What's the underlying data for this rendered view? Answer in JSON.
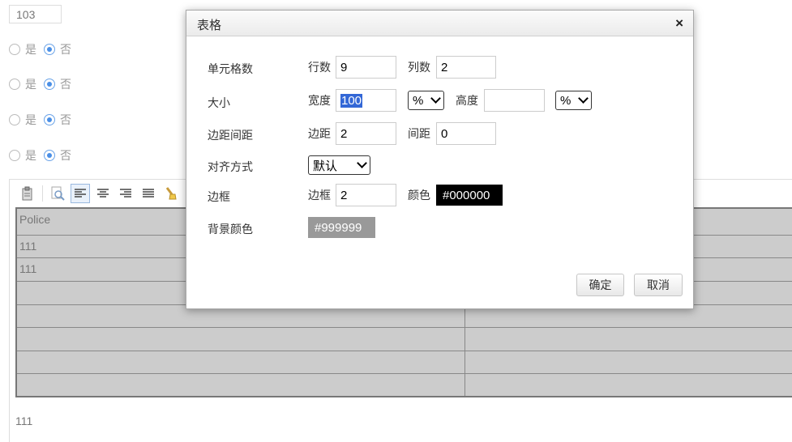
{
  "page": {
    "top_input_value": "103",
    "radio_rows": [
      {
        "yes": "是",
        "no": "否",
        "selected": "no"
      },
      {
        "yes": "是",
        "no": "否",
        "selected": "no"
      },
      {
        "yes": "是",
        "no": "否",
        "selected": "no"
      },
      {
        "yes": "是",
        "no": "否",
        "selected": "no"
      }
    ],
    "toolbar_icons": [
      "paste-icon",
      "preview-icon",
      "align-left-icon",
      "align-center-icon",
      "align-right-icon",
      "justify-icon",
      "brush-icon"
    ],
    "table": {
      "header": "Police",
      "rows": [
        "111",
        "111",
        "",
        "",
        "",
        "",
        ""
      ]
    },
    "after_table_text": "111"
  },
  "dialog": {
    "title": "表格",
    "close_glyph": "×",
    "cells": {
      "label": "单元格数",
      "rows_label": "行数",
      "rows_value": "9",
      "cols_label": "列数",
      "cols_value": "2"
    },
    "size": {
      "label": "大小",
      "width_label": "宽度",
      "width_value": "100",
      "width_unit": "%",
      "height_label": "高度",
      "height_value": "",
      "height_unit": "%"
    },
    "spacing": {
      "label": "边距间距",
      "padding_label": "边距",
      "padding_value": "2",
      "spacing_label": "间距",
      "spacing_value": "0"
    },
    "align": {
      "label": "对齐方式",
      "value": "默认"
    },
    "border": {
      "label": "边框",
      "width_label": "边框",
      "width_value": "2",
      "color_label": "颜色",
      "color_value": "#000000"
    },
    "background": {
      "label": "背景颜色",
      "value": "#999999"
    },
    "ok_label": "确定",
    "cancel_label": "取消"
  },
  "colors": {
    "border_color_swatch": "#000000",
    "background_swatch": "#999999",
    "table_fill": "#cccccc",
    "selection": "#3367d6"
  }
}
